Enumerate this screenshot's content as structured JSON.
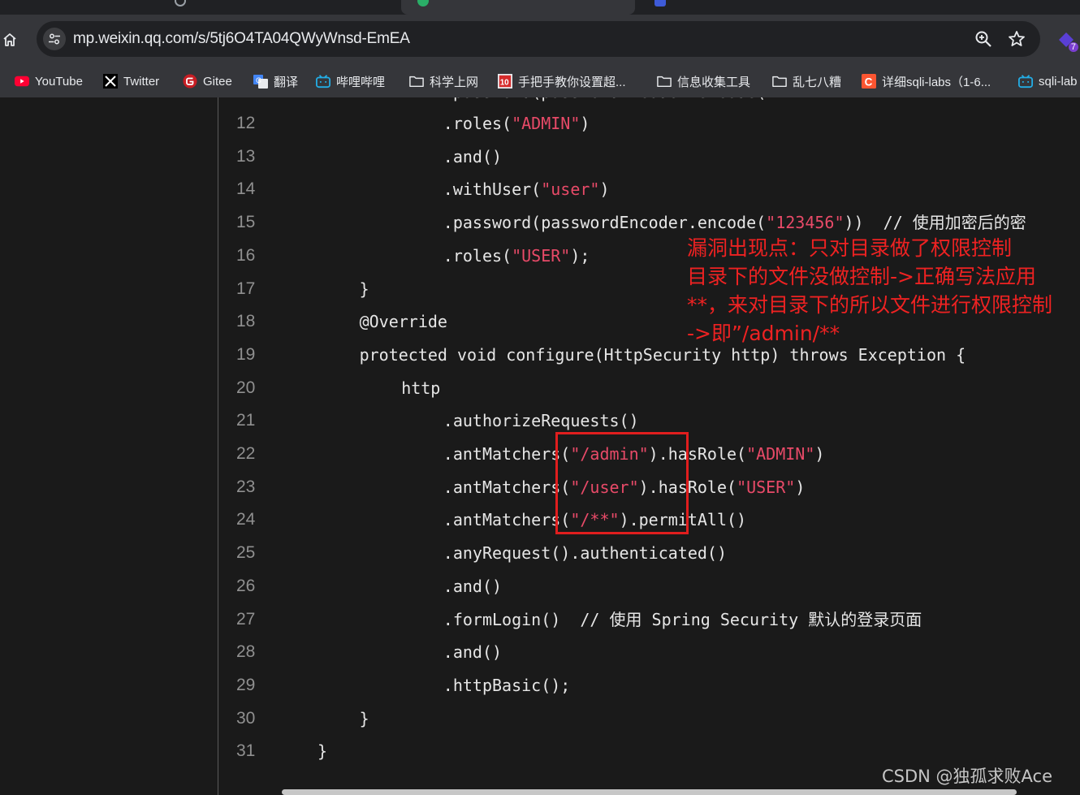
{
  "tabs": [
    {
      "label": ""
    },
    {
      "label": ""
    },
    {
      "label": ""
    },
    {
      "label": ""
    }
  ],
  "address_bar": {
    "url": "mp.weixin.qq.com/s/5tj6O4TA04QWyWnsd-EmEA"
  },
  "extension": {
    "badge": "7"
  },
  "bookmarks": [
    {
      "label": "YouTube",
      "icon": "youtube-icon"
    },
    {
      "label": "Twitter",
      "icon": "x-icon"
    },
    {
      "label": "Gitee",
      "icon": "gitee-icon"
    },
    {
      "label": "翻译",
      "icon": "translate-icon"
    },
    {
      "label": "哔哩哔哩",
      "icon": "bilibili-icon"
    },
    {
      "label": "科学上网",
      "icon": "folder-icon"
    },
    {
      "label": "手把手教你设置超...",
      "icon": "tenbu-icon"
    },
    {
      "label": "信息收集工具",
      "icon": "folder-icon"
    },
    {
      "label": "乱七八糟",
      "icon": "folder-icon"
    },
    {
      "label": "详细sqli-labs（1-6...",
      "icon": "csdn-icon"
    },
    {
      "label": "sqli-lab",
      "icon": "bilibili-icon"
    }
  ],
  "code_lines": [
    {
      "n": "12",
      "indent": 12,
      "tokens": [
        {
          "t": ".roles(",
          "c": "p"
        },
        {
          "t": "\"ADMIN\"",
          "c": "s"
        },
        {
          "t": ")",
          "c": "p"
        }
      ]
    },
    {
      "n": "13",
      "indent": 12,
      "tokens": [
        {
          "t": ".and()",
          "c": "p"
        }
      ]
    },
    {
      "n": "14",
      "indent": 12,
      "tokens": [
        {
          "t": ".withUser(",
          "c": "p"
        },
        {
          "t": "\"user\"",
          "c": "s"
        },
        {
          "t": ")",
          "c": "p"
        }
      ]
    },
    {
      "n": "15",
      "indent": 12,
      "tokens": [
        {
          "t": ".password(passwordEncoder.encode(",
          "c": "p"
        },
        {
          "t": "\"123456\"",
          "c": "s"
        },
        {
          "t": "))  // 使用加密后的密",
          "c": "p"
        }
      ]
    },
    {
      "n": "16",
      "indent": 12,
      "tokens": [
        {
          "t": ".roles(",
          "c": "p"
        },
        {
          "t": "\"USER\"",
          "c": "s"
        },
        {
          "t": ");",
          "c": "p"
        }
      ]
    },
    {
      "n": "17",
      "indent": 4,
      "tokens": [
        {
          "t": "}",
          "c": "p"
        }
      ]
    },
    {
      "n": "18",
      "indent": 4,
      "tokens": [
        {
          "t": "@Override",
          "c": "p"
        }
      ]
    },
    {
      "n": "19",
      "indent": 4,
      "tokens": [
        {
          "t": "protected void configure(HttpSecurity http) throws Exception {",
          "c": "p"
        }
      ]
    },
    {
      "n": "20",
      "indent": 8,
      "tokens": [
        {
          "t": "http",
          "c": "p"
        }
      ]
    },
    {
      "n": "21",
      "indent": 12,
      "tokens": [
        {
          "t": ".authorizeRequests()",
          "c": "p"
        }
      ]
    },
    {
      "n": "22",
      "indent": 12,
      "tokens": [
        {
          "t": ".antMatchers(",
          "c": "p"
        },
        {
          "t": "\"/admin\"",
          "c": "s"
        },
        {
          "t": ").hasRole(",
          "c": "p"
        },
        {
          "t": "\"ADMIN\"",
          "c": "s"
        },
        {
          "t": ")",
          "c": "p"
        }
      ]
    },
    {
      "n": "23",
      "indent": 12,
      "tokens": [
        {
          "t": ".antMatchers(",
          "c": "p"
        },
        {
          "t": "\"/user\"",
          "c": "s"
        },
        {
          "t": ").hasRole(",
          "c": "p"
        },
        {
          "t": "\"USER\"",
          "c": "s"
        },
        {
          "t": ")",
          "c": "p"
        }
      ]
    },
    {
      "n": "24",
      "indent": 12,
      "tokens": [
        {
          "t": ".antMatchers(",
          "c": "p"
        },
        {
          "t": "\"/**\"",
          "c": "s"
        },
        {
          "t": ").permitAll()",
          "c": "p"
        }
      ]
    },
    {
      "n": "25",
      "indent": 12,
      "tokens": [
        {
          "t": ".anyRequest().authenticated()",
          "c": "p"
        }
      ]
    },
    {
      "n": "26",
      "indent": 12,
      "tokens": [
        {
          "t": ".and()",
          "c": "p"
        }
      ]
    },
    {
      "n": "27",
      "indent": 12,
      "tokens": [
        {
          "t": ".formLogin()  // 使用 Spring Security 默认的登录页面",
          "c": "p"
        }
      ]
    },
    {
      "n": "28",
      "indent": 12,
      "tokens": [
        {
          "t": ".and()",
          "c": "p"
        }
      ]
    },
    {
      "n": "29",
      "indent": 12,
      "tokens": [
        {
          "t": ".httpBasic();",
          "c": "p"
        }
      ]
    },
    {
      "n": "30",
      "indent": 4,
      "tokens": [
        {
          "t": "}",
          "c": "p"
        }
      ]
    },
    {
      "n": "31",
      "indent": 0,
      "tokens": [
        {
          "t": "}",
          "c": "p"
        }
      ]
    }
  ],
  "annotation": {
    "lines": [
      "漏洞出现点：只对目录做了权限控制",
      "目录下的文件没做控制->正确写法应用",
      "**，来对目录下的所以文件进行权限控制",
      "->即”/admin/**"
    ],
    "color": "#ee2222"
  },
  "watermark": "CSDN @独孤求败Ace",
  "colors": {
    "string": "#e84a68",
    "plain": "#e6e6e6",
    "highlight_box": "#e01e1e"
  }
}
